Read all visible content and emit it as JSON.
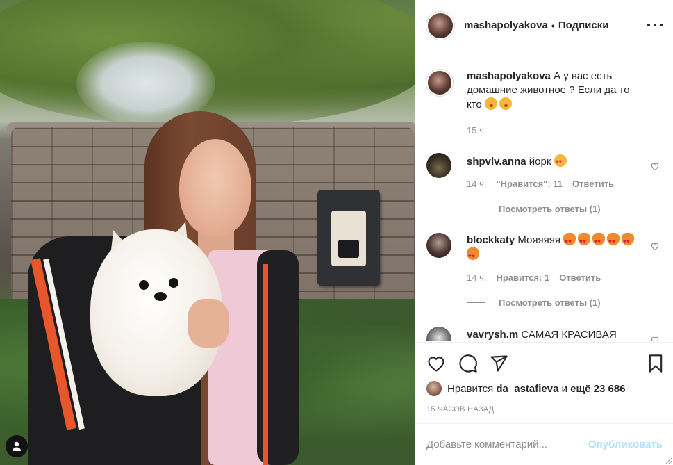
{
  "header": {
    "username": "mashapolyakova",
    "separator": "•",
    "follow_label": "Подписки",
    "more_icon": "more-dots-icon"
  },
  "caption": {
    "username": "mashapolyakova",
    "text": "А у вас есть домашние животное ? Если да то кто",
    "emojis": [
      "face-blowing-kiss",
      "face-savoring-food"
    ],
    "time": "15 ч."
  },
  "comments": [
    {
      "username": "shpvlv.anna",
      "text": "йорк",
      "emojis": [
        "smiling-face-heart-eyes"
      ],
      "time": "14 ч.",
      "likes_label": "\"Нравится\": 11",
      "reply_label": "Ответить",
      "view_replies": "Посмотреть ответы (1)"
    },
    {
      "username": "blockkaty",
      "text": "Мояяяяя",
      "emojis": [
        "cat-heart-eyes",
        "cat-heart-eyes",
        "cat-heart-eyes",
        "cat-heart-eyes",
        "cat-heart-eyes",
        "cat-heart-eyes"
      ],
      "time": "14 ч.",
      "likes_label": "Нравится: 1",
      "reply_label": "Ответить",
      "view_replies": "Посмотреть ответы (1)"
    },
    {
      "username": "vavrysh.m",
      "text": "САМАЯ КРАСИВАЯ"
    }
  ],
  "likes": {
    "prefix": "Нравится",
    "user": "da_astafieva",
    "and": "и",
    "count_text": "ещё 23 686"
  },
  "timestamp": "15 ЧАСОВ НАЗАД",
  "add_comment": {
    "placeholder": "Добавьте комментарий...",
    "publish_label": "Опубликовать"
  },
  "colors": {
    "text": "#262626",
    "secondary": "#8e8e8e",
    "border": "#efefef",
    "publish_disabled": "#b2dffc"
  }
}
